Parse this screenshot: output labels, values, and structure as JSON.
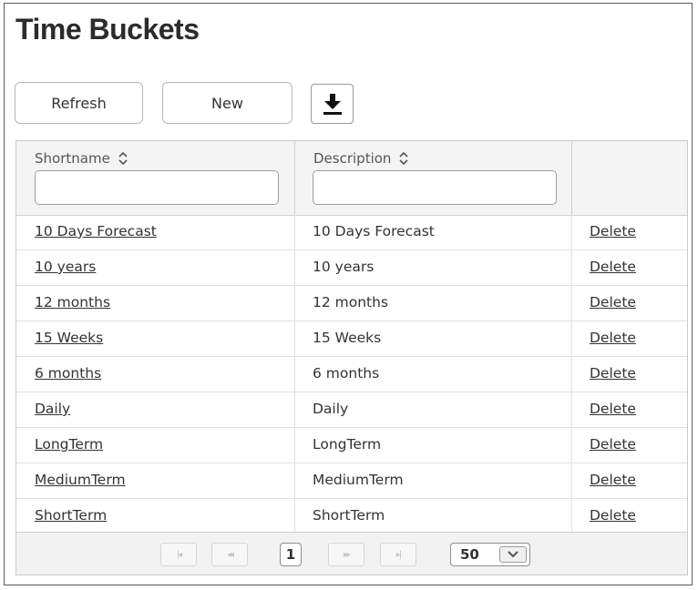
{
  "page": {
    "title": "Time Buckets"
  },
  "toolbar": {
    "refresh_label": "Refresh",
    "new_label": "New",
    "download_icon": "download-icon"
  },
  "table": {
    "columns": [
      {
        "label": "Shortname",
        "filter_value": ""
      },
      {
        "label": "Description",
        "filter_value": ""
      },
      {
        "label": ""
      }
    ],
    "rows": [
      {
        "shortname": "10 Days Forecast",
        "description": "10 Days Forecast",
        "action": "Delete"
      },
      {
        "shortname": "10 years",
        "description": "10 years",
        "action": "Delete"
      },
      {
        "shortname": "12 months",
        "description": "12 months",
        "action": "Delete"
      },
      {
        "shortname": "15 Weeks",
        "description": "15 Weeks",
        "action": "Delete"
      },
      {
        "shortname": "6 months",
        "description": "6 months",
        "action": "Delete"
      },
      {
        "shortname": "Daily",
        "description": "Daily",
        "action": "Delete"
      },
      {
        "shortname": "LongTerm",
        "description": "LongTerm",
        "action": "Delete"
      },
      {
        "shortname": "MediumTerm",
        "description": "MediumTerm",
        "action": "Delete"
      },
      {
        "shortname": "ShortTerm",
        "description": "ShortTerm",
        "action": "Delete"
      }
    ]
  },
  "pager": {
    "first_glyph": "|◂",
    "prev_glyph": "◂◂",
    "current_page": "1",
    "next_glyph": "▸▸",
    "last_glyph": "▸|",
    "page_size": "50"
  }
}
